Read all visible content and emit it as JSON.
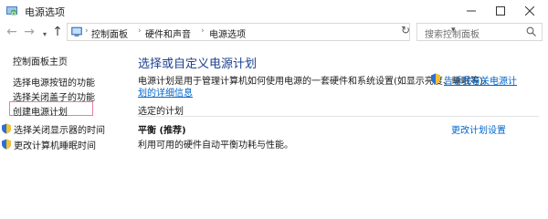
{
  "window": {
    "title": "电源选项",
    "icons": {
      "app": "power-options-icon",
      "minimize": "minimize-icon",
      "maximize": "maximize-icon",
      "close": "close-icon"
    }
  },
  "nav": {
    "back_icon": "arrow-left-icon",
    "forward_icon": "arrow-right-icon",
    "recent_icon": "chevron-down-icon",
    "up_icon": "arrow-up-icon",
    "breadcrumbs": [
      "控制面板",
      "硬件和声音",
      "电源选项"
    ],
    "refresh_icon": "refresh-icon",
    "search_placeholder": "搜索控制面板"
  },
  "sidebar": {
    "items": [
      {
        "label": "控制面板主页"
      },
      {
        "label": "选择电源按钮的功能"
      },
      {
        "label": "选择关闭盖子的功能"
      },
      {
        "label": "创建电源计划",
        "highlighted": true
      },
      {
        "label": "选择关闭显示器的时间",
        "icon": "shield-icon"
      },
      {
        "label": "更改计算机睡眠时间",
        "icon": "shield-icon"
      }
    ],
    "highlight_color": "#e77fa8"
  },
  "main": {
    "title": "选择或自定义电源计划",
    "description": "电源计划是用于管理计算机如何使用电源的一套硬件和系统设置(如显示亮度、睡眠等)。",
    "learn_more_1": "告诉我有关电源计",
    "learn_more_2": "划的详细信息",
    "selected_heading": "选定的计划",
    "plan": {
      "name": "平衡 (推荐)",
      "description": "利用可用的硬件自动平衡功耗与性能。",
      "change_link": "更改计划设置"
    }
  },
  "colors": {
    "link": "#0066cc",
    "heading": "#1b3f8f"
  }
}
